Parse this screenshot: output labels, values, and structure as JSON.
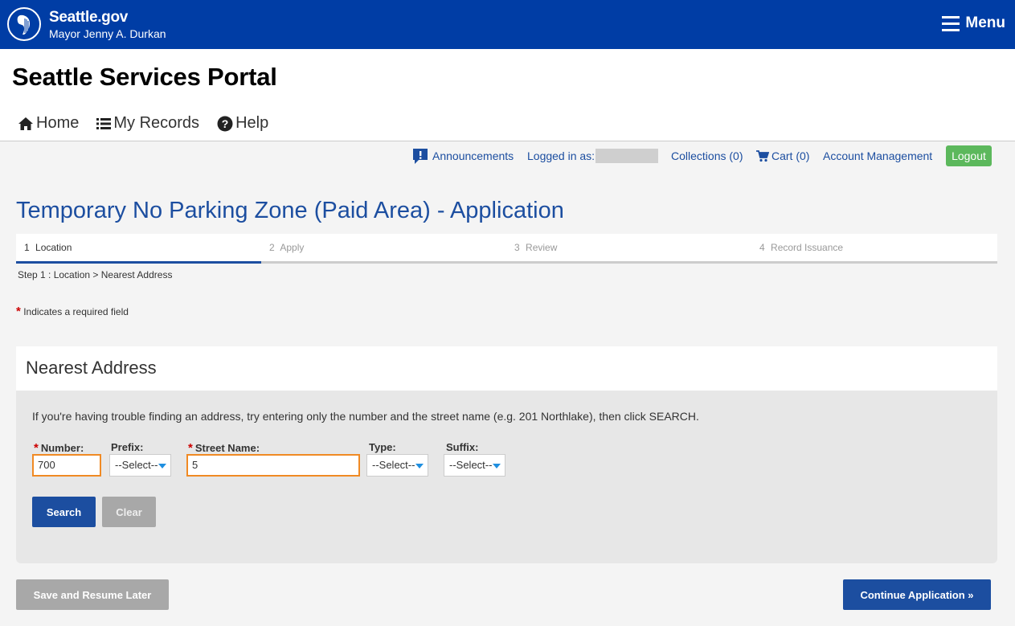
{
  "topbar": {
    "brand_name": "Seattle.gov",
    "brand_sub": "Mayor Jenny A. Durkan",
    "menu_label": "Menu"
  },
  "portal": {
    "title": "Seattle Services Portal",
    "nav": [
      {
        "label": "Home",
        "icon": "home-icon"
      },
      {
        "label": "My Records",
        "icon": "list-icon"
      },
      {
        "label": "Help",
        "icon": "question-circle-icon"
      }
    ]
  },
  "utility": {
    "announcements": "Announcements",
    "logged_in": "Logged in as:",
    "collections": "Collections (0)",
    "cart": "Cart (0)",
    "account": "Account Management",
    "logout": "Logout"
  },
  "page": {
    "title": "Temporary No Parking Zone (Paid Area) - Application"
  },
  "stepper": {
    "steps": [
      {
        "num": "1",
        "label": "Location",
        "active": true
      },
      {
        "num": "2",
        "label": "Apply",
        "active": false
      },
      {
        "num": "3",
        "label": "Review",
        "active": false
      },
      {
        "num": "4",
        "label": "Record Issuance",
        "active": false
      }
    ],
    "description": "Step 1 : Location > Nearest Address",
    "required_note": "Indicates a required field"
  },
  "nearest_address": {
    "title": "Nearest Address",
    "info": "If you're having trouble finding an address, try entering only the number and the street name (e.g. 201 Northlake), then click SEARCH.",
    "fields": {
      "number_label": "Number:",
      "number_value": "700",
      "prefix_label": "Prefix:",
      "prefix_value": "--Select--",
      "street_label": "Street Name:",
      "street_value": "5",
      "type_label": "Type:",
      "type_value": "--Select--",
      "suffix_label": "Suffix:",
      "suffix_value": "--Select--"
    },
    "search_label": "Search",
    "clear_label": "Clear"
  },
  "footer_actions": {
    "save_label": "Save and Resume Later",
    "continue_label": "Continue Application »"
  },
  "colors": {
    "brand_blue": "#003da5",
    "link_blue": "#1c4ea0",
    "logout_green": "#5cb85c",
    "focus_orange": "#f08a24",
    "required_red": "#cc0000"
  }
}
